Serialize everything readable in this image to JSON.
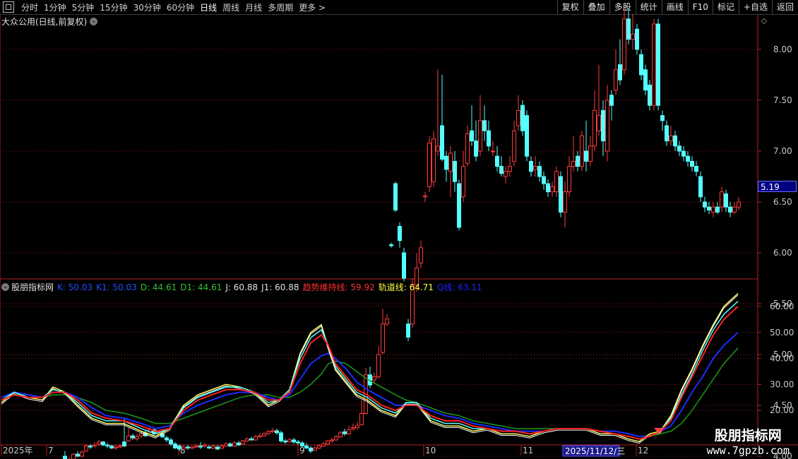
{
  "toolbar": {
    "periods": [
      "分时",
      "1分钟",
      "5分钟",
      "15分钟",
      "30分钟",
      "60分钟",
      "日线",
      "周线",
      "月线",
      "多周期",
      "更多 >"
    ],
    "active_period": "日线",
    "right_buttons": [
      "复权",
      "叠加",
      "多股",
      "统计",
      "画线",
      "F10",
      "标记",
      "+自选",
      "返回"
    ]
  },
  "main_chart": {
    "title": "大众公用(日线,前复权)",
    "current_price_tag": "5.19",
    "y_ticks": [
      "8.00",
      "7.50",
      "7.00",
      "6.50",
      "6.00",
      "5.50",
      "5.00",
      "4.50",
      "4.00"
    ]
  },
  "indicator": {
    "name": "股朋指标网",
    "values": [
      {
        "label": "K: 50.03",
        "color": "#2050ff"
      },
      {
        "label": "K1: 50.03",
        "color": "#2050ff"
      },
      {
        "label": "D: 44.61",
        "color": "#30c030"
      },
      {
        "label": "D1: 44.61",
        "color": "#30c030"
      },
      {
        "label": "J: 60.88",
        "color": "#e0e0e0"
      },
      {
        "label": "J1: 60.88",
        "color": "#e0e0e0"
      },
      {
        "label": "趋势维持线: 59.92",
        "color": "#ff3030"
      },
      {
        "label": "轨道线: 64.71",
        "color": "#ffff40"
      },
      {
        "label": "Q线: 63.11",
        "color": "#2020ff"
      }
    ],
    "y_ticks": [
      "60.00",
      "50.00",
      "40.00",
      "30.00",
      "20.00"
    ]
  },
  "x_axis": {
    "labels": [
      "2025年",
      "7",
      "8",
      "9",
      "10",
      "11",
      "12"
    ],
    "highlight_date": "2025/11/12/三"
  },
  "watermark": {
    "line1": "股朋指标网",
    "line2": "www.7gpzb.com"
  },
  "colors": {
    "up": "#ff3c3c",
    "down": "#54ffff",
    "grid": "#8b1a1a",
    "axis": "#b22222"
  }
}
